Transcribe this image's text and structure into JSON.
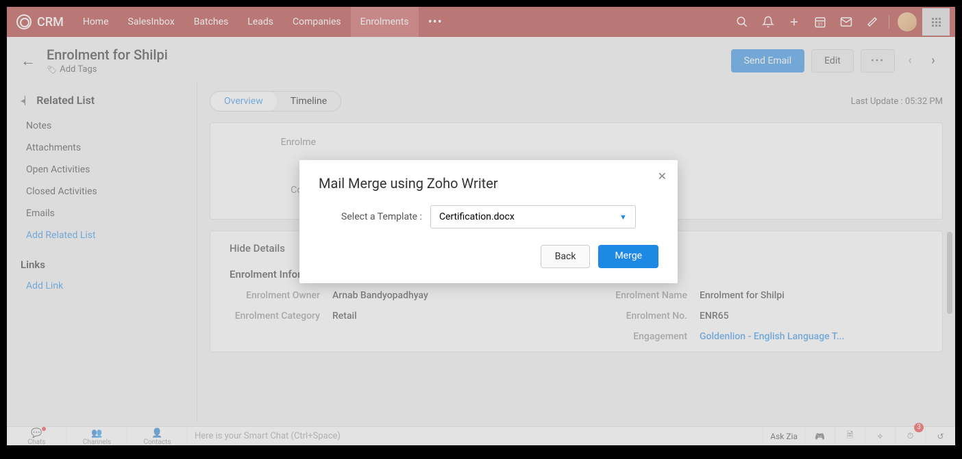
{
  "brand": "CRM",
  "nav": {
    "items": [
      "Home",
      "SalesInbox",
      "Batches",
      "Leads",
      "Companies",
      "Enrolments"
    ],
    "active": "Enrolments",
    "more": "•••"
  },
  "header": {
    "title": "Enrolment for Shilpi",
    "add_tags": "Add Tags",
    "send_email": "Send Email",
    "edit": "Edit",
    "more": "•••"
  },
  "sidebar": {
    "heading": "Related List",
    "items": [
      "Notes",
      "Attachments",
      "Open Activities",
      "Closed Activities",
      "Emails"
    ],
    "add_related": "Add Related List",
    "links_heading": "Links",
    "add_link": "Add Link"
  },
  "tabs": {
    "overview": "Overview",
    "timeline": "Timeline",
    "last_update": "Last Update : 05:32 PM"
  },
  "top_card": {
    "field1_label": "Enrolme",
    "field2_label": "Cours"
  },
  "details": {
    "hide": "Hide Details",
    "section": "Enrolment Information",
    "left": [
      {
        "label": "Enrolment Owner",
        "value": "Arnab Bandyopadhyay"
      },
      {
        "label": "Enrolment Category",
        "value": "Retail"
      }
    ],
    "right": [
      {
        "label": "Enrolment Name",
        "value": "Enrolment for Shilpi"
      },
      {
        "label": "Enrolment No.",
        "value": "ENR65"
      },
      {
        "label": "Engagement",
        "value": "Goldenlion - English Language T..."
      }
    ]
  },
  "modal": {
    "title": "Mail Merge using Zoho Writer",
    "template_label": "Select a Template :",
    "template_value": "Certification.docx",
    "back": "Back",
    "merge": "Merge"
  },
  "bottombar": {
    "chats": "Chats",
    "channels": "Channels",
    "contacts": "Contacts",
    "smart_chat": "Here is your Smart Chat (Ctrl+Space)",
    "ask_zia": "Ask Zia",
    "badge": "3"
  }
}
